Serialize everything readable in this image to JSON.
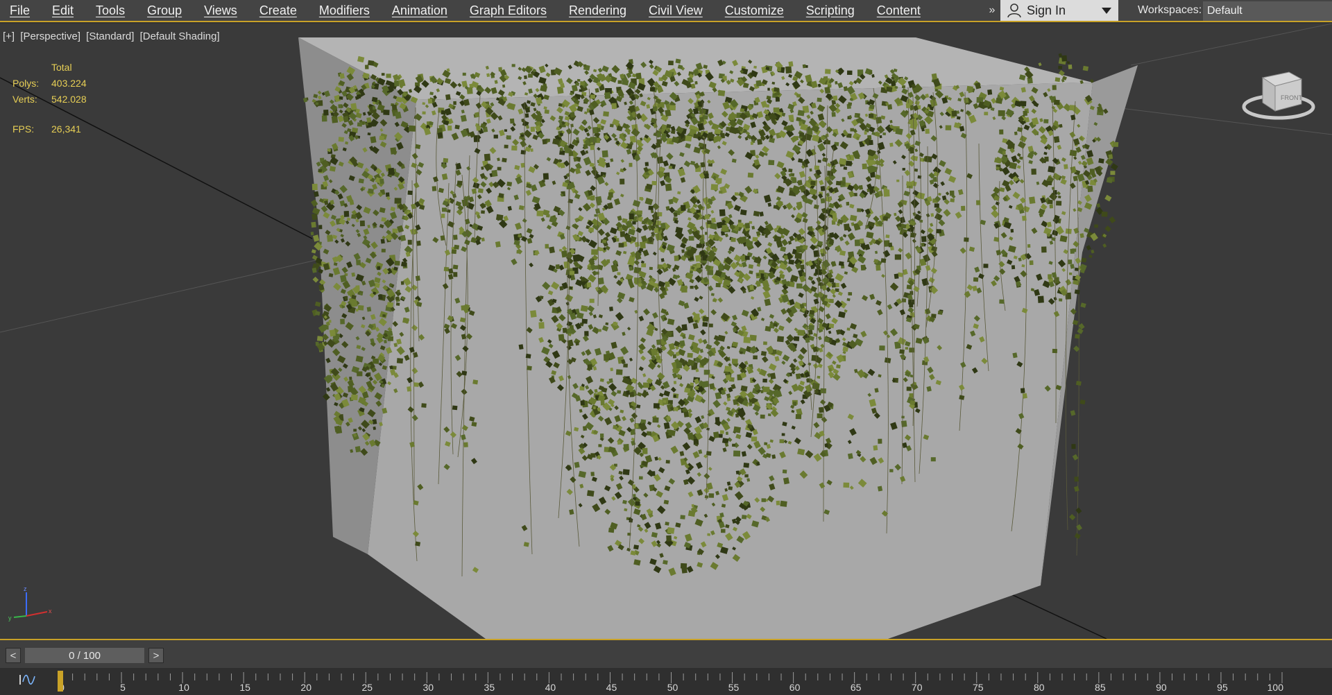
{
  "menu": {
    "items": [
      "File",
      "Edit",
      "Tools",
      "Group",
      "Views",
      "Create",
      "Modifiers",
      "Animation",
      "Graph Editors",
      "Rendering",
      "Civil View",
      "Customize",
      "Scripting",
      "Content"
    ],
    "overflow": "»"
  },
  "account": {
    "sign_in_label": "Sign In"
  },
  "workspace": {
    "label": "Workspaces:",
    "value": "Default"
  },
  "viewport": {
    "labels": [
      "[+]",
      "[Perspective]",
      "[Standard]",
      "[Default Shading]"
    ],
    "stats": {
      "total_label": "Total",
      "polys_label": "Polys:",
      "polys_value": "403.224",
      "verts_label": "Verts:",
      "verts_value": "542.028",
      "fps_label": "FPS:",
      "fps_value": "26,341"
    },
    "viewcube_label": "FRONT"
  },
  "timeline": {
    "prev_label": "<",
    "next_label": ">",
    "frame_display": "0 / 100",
    "current_frame": 0,
    "start": 0,
    "end": 100,
    "tick_labels": [
      0,
      5,
      10,
      15,
      20,
      25,
      30,
      35,
      40,
      45,
      50,
      55,
      60,
      65,
      70,
      75,
      80,
      85,
      90,
      95,
      100
    ]
  },
  "colors": {
    "accent": "#c9a227",
    "stats_text": "#e7cf55",
    "viewport_bg": "#3a3a3a",
    "box_face": "#a8a8a8",
    "ivy": "#5c6e2a"
  }
}
